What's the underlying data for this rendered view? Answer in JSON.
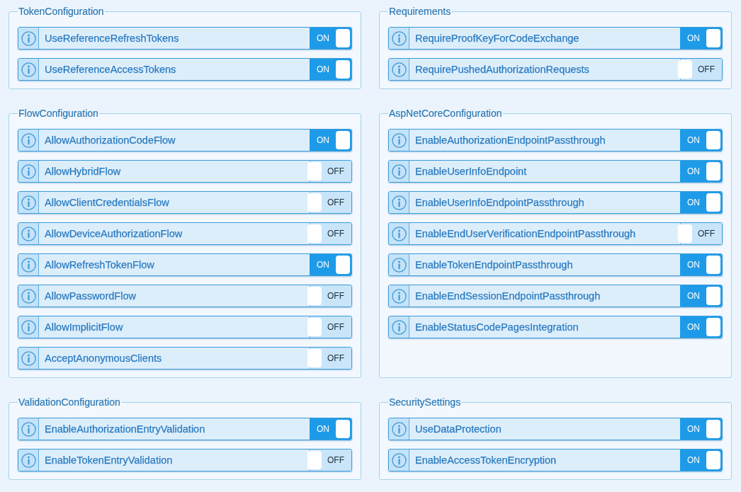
{
  "sections": [
    {
      "title": "TokenConfiguration",
      "settings": [
        {
          "label": "UseReferenceRefreshTokens",
          "on": true,
          "toggle_text": "ON"
        },
        {
          "label": "UseReferenceAccessTokens",
          "on": true,
          "toggle_text": "ON"
        }
      ]
    },
    {
      "title": "Requirements",
      "settings": [
        {
          "label": "RequireProofKeyForCodeExchange",
          "on": true,
          "toggle_text": "ON"
        },
        {
          "label": "RequirePushedAuthorizationRequests",
          "on": false,
          "toggle_text": "OFF"
        }
      ]
    },
    {
      "title": "FlowConfiguration",
      "settings": [
        {
          "label": "AllowAuthorizationCodeFlow",
          "on": true,
          "toggle_text": "ON"
        },
        {
          "label": "AllowHybridFlow",
          "on": false,
          "toggle_text": "OFF"
        },
        {
          "label": "AllowClientCredentialsFlow",
          "on": false,
          "toggle_text": "OFF"
        },
        {
          "label": "AllowDeviceAuthorizationFlow",
          "on": false,
          "toggle_text": "OFF"
        },
        {
          "label": "AllowRefreshTokenFlow",
          "on": true,
          "toggle_text": "ON"
        },
        {
          "label": "AllowPasswordFlow",
          "on": false,
          "toggle_text": "OFF"
        },
        {
          "label": "AllowImplicitFlow",
          "on": false,
          "toggle_text": "OFF"
        },
        {
          "label": "AcceptAnonymousClients",
          "on": false,
          "toggle_text": "OFF"
        }
      ]
    },
    {
      "title": "AspNetCoreConfiguration",
      "settings": [
        {
          "label": "EnableAuthorizationEndpointPassthrough",
          "on": true,
          "toggle_text": "ON"
        },
        {
          "label": "EnableUserInfoEndpoint",
          "on": true,
          "toggle_text": "ON"
        },
        {
          "label": "EnableUserInfoEndpointPassthrough",
          "on": true,
          "toggle_text": "ON"
        },
        {
          "label": "EnableEndUserVerificationEndpointPassthrough",
          "on": false,
          "toggle_text": "OFF"
        },
        {
          "label": "EnableTokenEndpointPassthrough",
          "on": true,
          "toggle_text": "ON"
        },
        {
          "label": "EnableEndSessionEndpointPassthrough",
          "on": true,
          "toggle_text": "ON"
        },
        {
          "label": "EnableStatusCodePagesIntegration",
          "on": true,
          "toggle_text": "ON"
        }
      ]
    },
    {
      "title": "ValidationConfiguration",
      "settings": [
        {
          "label": "EnableAuthorizationEntryValidation",
          "on": true,
          "toggle_text": "ON"
        },
        {
          "label": "EnableTokenEntryValidation",
          "on": false,
          "toggle_text": "OFF"
        }
      ]
    },
    {
      "title": "SecuritySettings",
      "settings": [
        {
          "label": "UseDataProtection",
          "on": true,
          "toggle_text": "ON"
        },
        {
          "label": "EnableAccessTokenEncryption",
          "on": true,
          "toggle_text": "ON"
        }
      ]
    }
  ]
}
